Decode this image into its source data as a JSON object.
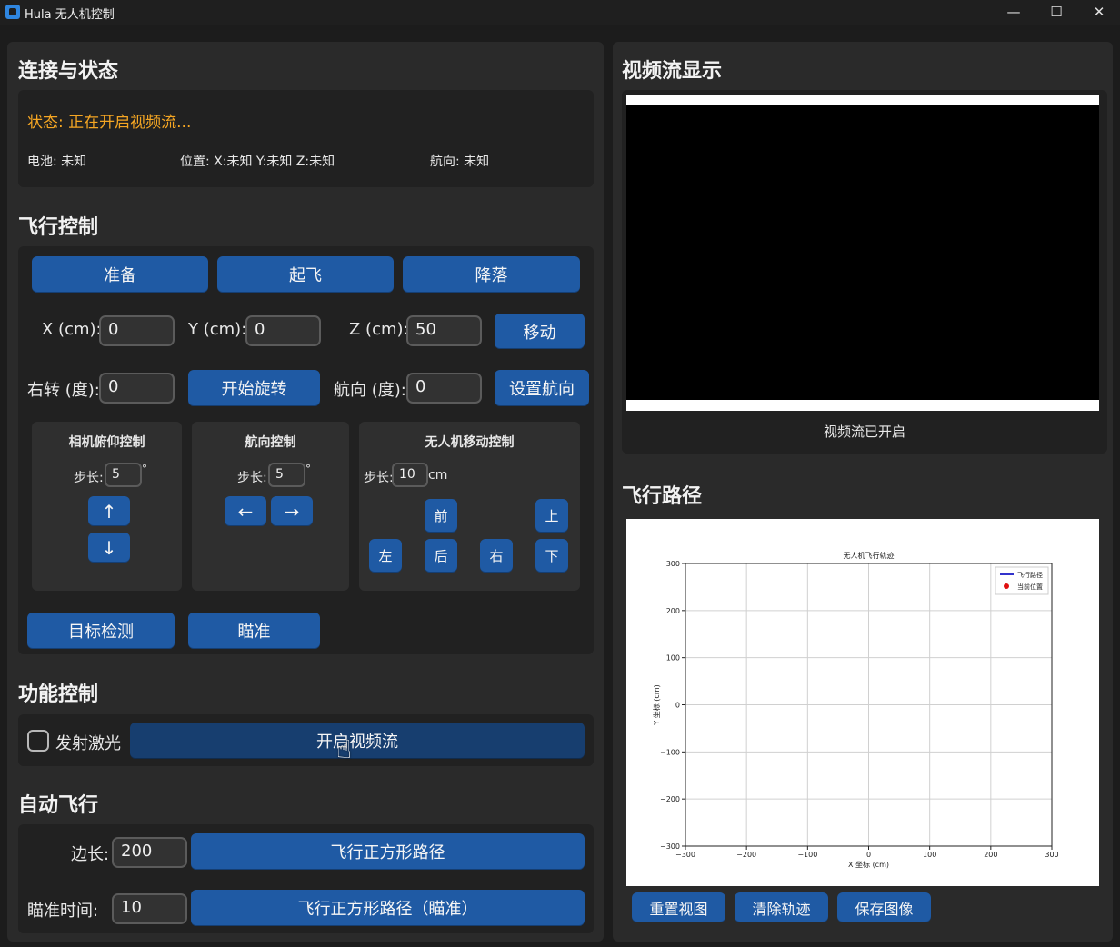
{
  "window": {
    "title": "Hula 无人机控制",
    "minimize": "—",
    "maximize": "☐",
    "close": "✕"
  },
  "connection": {
    "title": "连接与状态",
    "status": "状态: 正在开启视频流...",
    "battery": "电池: 未知",
    "position": "位置: X:未知 Y:未知 Z:未知",
    "heading": "航向: 未知"
  },
  "flight": {
    "title": "飞行控制",
    "prepare": "准备",
    "takeoff": "起飞",
    "land": "降落",
    "x_label": "X (cm):",
    "x_value": "0",
    "y_label": "Y (cm):",
    "y_value": "0",
    "z_label": "Z (cm):",
    "z_value": "50",
    "move": "移动",
    "turn_label": "右转 (度):",
    "turn_value": "0",
    "start_rotate": "开始旋转",
    "heading_label": "航向 (度):",
    "heading_value": "0",
    "set_heading": "设置航向",
    "camera": {
      "title": "相机俯仰控制",
      "step_label": "步长:",
      "step_value": "5",
      "unit": "°",
      "up": "↑",
      "down": "↓"
    },
    "yaw": {
      "title": "航向控制",
      "step_label": "步长:",
      "step_value": "5",
      "unit": "°",
      "left": "←",
      "right": "→"
    },
    "move_ctrl": {
      "title": "无人机移动控制",
      "step_label": "步长:",
      "step_value": "10",
      "unit": "cm",
      "forward": "前",
      "back": "后",
      "left": "左",
      "right": "右",
      "up": "上",
      "down": "下"
    },
    "detect": "目标检测",
    "aim": "瞄准"
  },
  "function": {
    "title": "功能控制",
    "laser": "发射激光",
    "video": "开启视频流"
  },
  "auto": {
    "title": "自动飞行",
    "side_label": "边长:",
    "side_value": "200",
    "fly_square": "飞行正方形路径",
    "aim_time_label": "瞄准时间:",
    "aim_time_value": "10",
    "fly_square_aim": "飞行正方形路径（瞄准）"
  },
  "video_panel": {
    "title": "视频流显示",
    "status": "视频流已开启"
  },
  "path_panel": {
    "title": "飞行路径",
    "reset": "重置视图",
    "clear": "清除轨迹",
    "save": "保存图像"
  },
  "chart_data": {
    "type": "line",
    "title": "无人机飞行轨迹",
    "xlabel": "X 坐标 (cm)",
    "ylabel": "Y 坐标 (cm)",
    "xlim": [
      -300,
      300
    ],
    "ylim": [
      -300,
      300
    ],
    "xticks": [
      "−300",
      "−200",
      "−100",
      "0",
      "100",
      "200",
      "300"
    ],
    "yticks": [
      "300",
      "200",
      "100",
      "0",
      "−100",
      "−200",
      "−300"
    ],
    "grid": true,
    "legend_position": "top-right",
    "series": [
      {
        "name": "飞行路径",
        "color": "#3333cc",
        "x": [],
        "y": []
      },
      {
        "name": "当前位置",
        "color": "#e01010",
        "x": [],
        "y": []
      }
    ]
  }
}
